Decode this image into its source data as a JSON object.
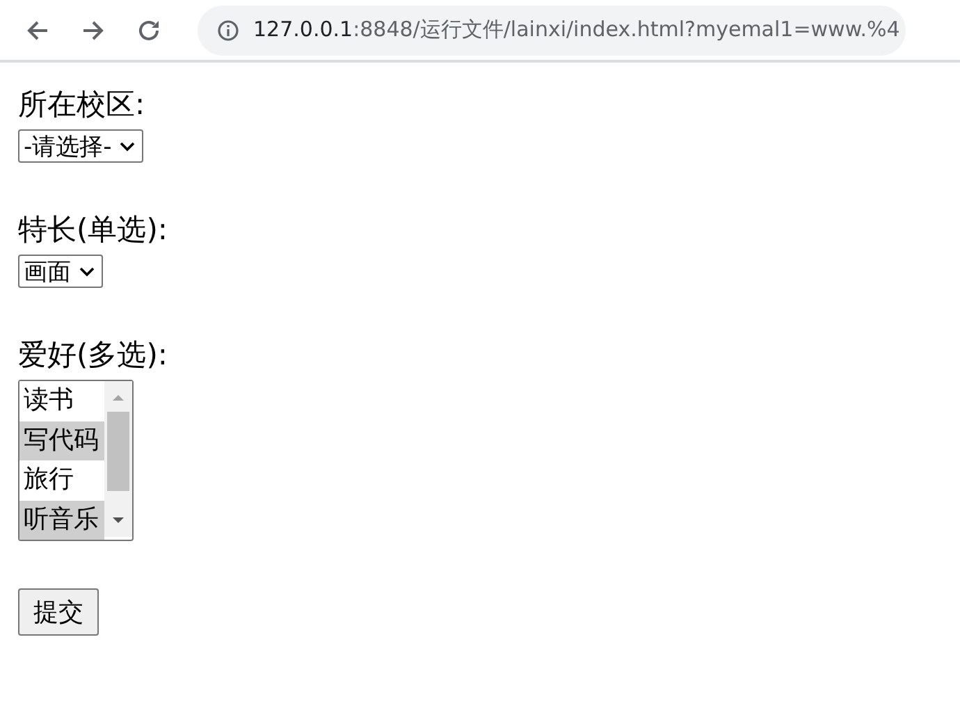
{
  "browser": {
    "url_host": "127.0.0.1",
    "url_rest": ":8848/运行文件/lainxi/index.html?myemal1=www.%4"
  },
  "form": {
    "fields": [
      {
        "kind": "dropdown",
        "label": "所在校区:",
        "value": "-请选择-"
      },
      {
        "kind": "dropdown",
        "label": "特长(单选):",
        "value": "画面"
      },
      {
        "kind": "listbox",
        "label": "爱好(多选):",
        "options": [
          {
            "text": "读书",
            "selected": false
          },
          {
            "text": "写代码",
            "selected": true
          },
          {
            "text": "旅行",
            "selected": false
          },
          {
            "text": "听音乐",
            "selected": true
          }
        ]
      }
    ],
    "submit": "提交"
  }
}
